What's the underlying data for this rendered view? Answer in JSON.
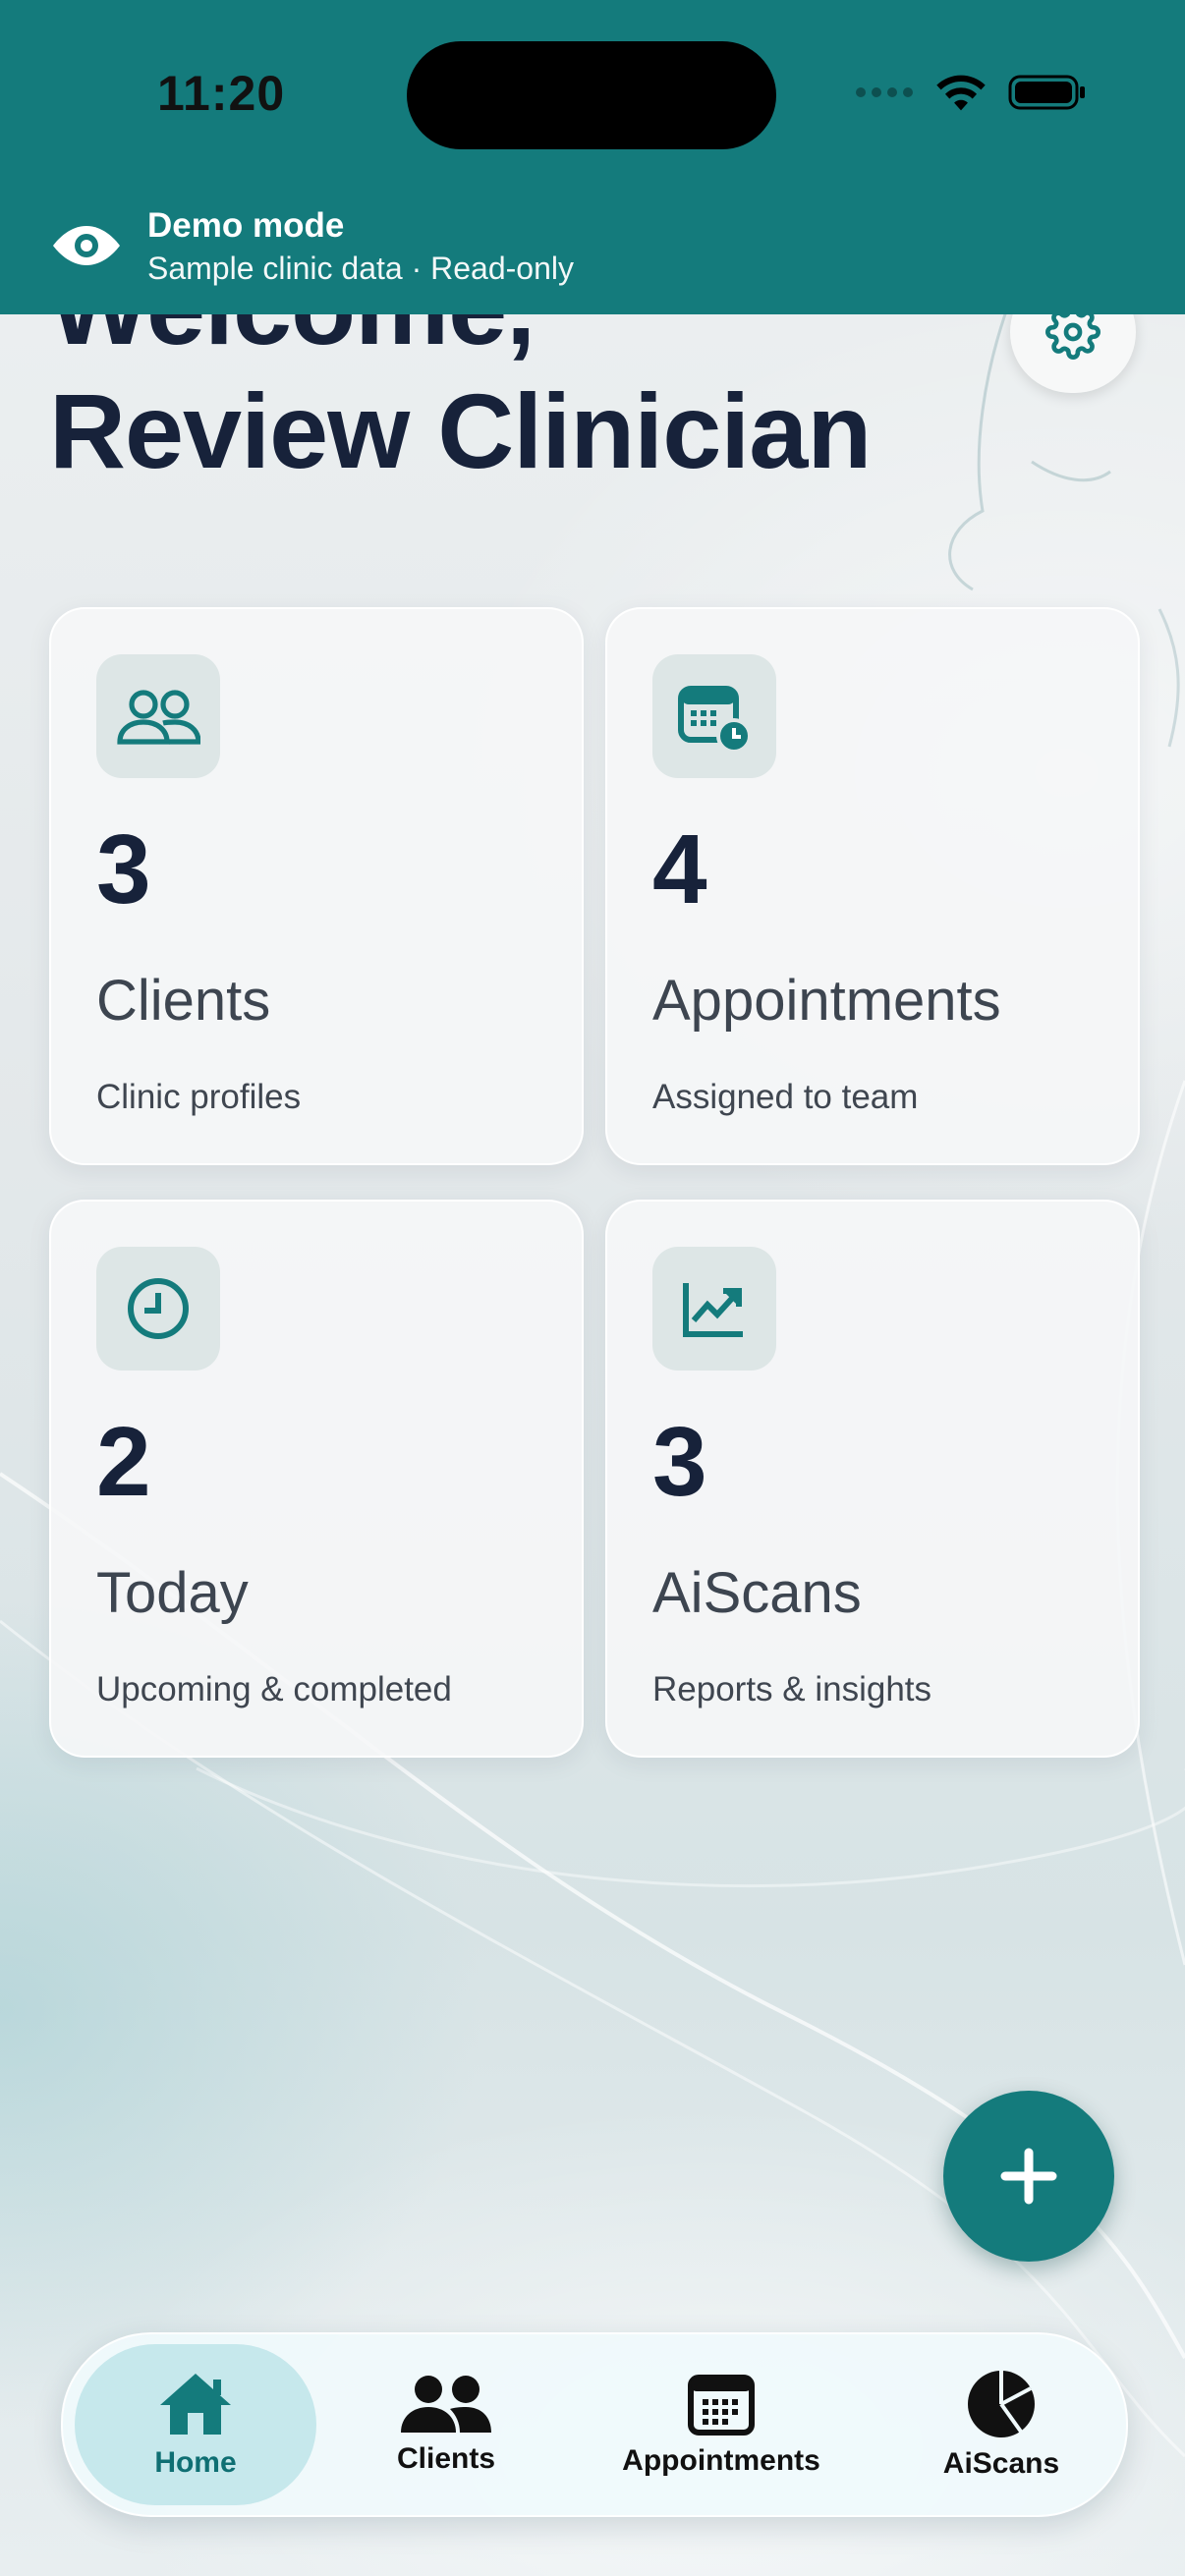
{
  "status": {
    "time": "11:20"
  },
  "banner": {
    "title": "Demo mode",
    "subtitle": "Sample clinic data · Read-only"
  },
  "welcome": {
    "line1": "Welcome,",
    "line2": "Review Clinician"
  },
  "cards": [
    {
      "value": "3",
      "label": "Clients",
      "sub": "Clinic profiles",
      "icon": "users-icon"
    },
    {
      "value": "4",
      "label": "Appointments",
      "sub": "Assigned to team",
      "icon": "calendar-clock-icon"
    },
    {
      "value": "2",
      "label": "Today",
      "sub": "Upcoming & completed",
      "icon": "clock-icon"
    },
    {
      "value": "3",
      "label": "AiScans",
      "sub": "Reports & insights",
      "icon": "trending-up-icon"
    }
  ],
  "tabs": [
    {
      "label": "Home",
      "icon": "home-icon",
      "active": true
    },
    {
      "label": "Clients",
      "icon": "users-icon"
    },
    {
      "label": "Appointments",
      "icon": "calendar-icon"
    },
    {
      "label": "AiScans",
      "icon": "pie-chart-icon"
    }
  ],
  "colors": {
    "accent": "#147b7c",
    "text": "#17223a"
  }
}
